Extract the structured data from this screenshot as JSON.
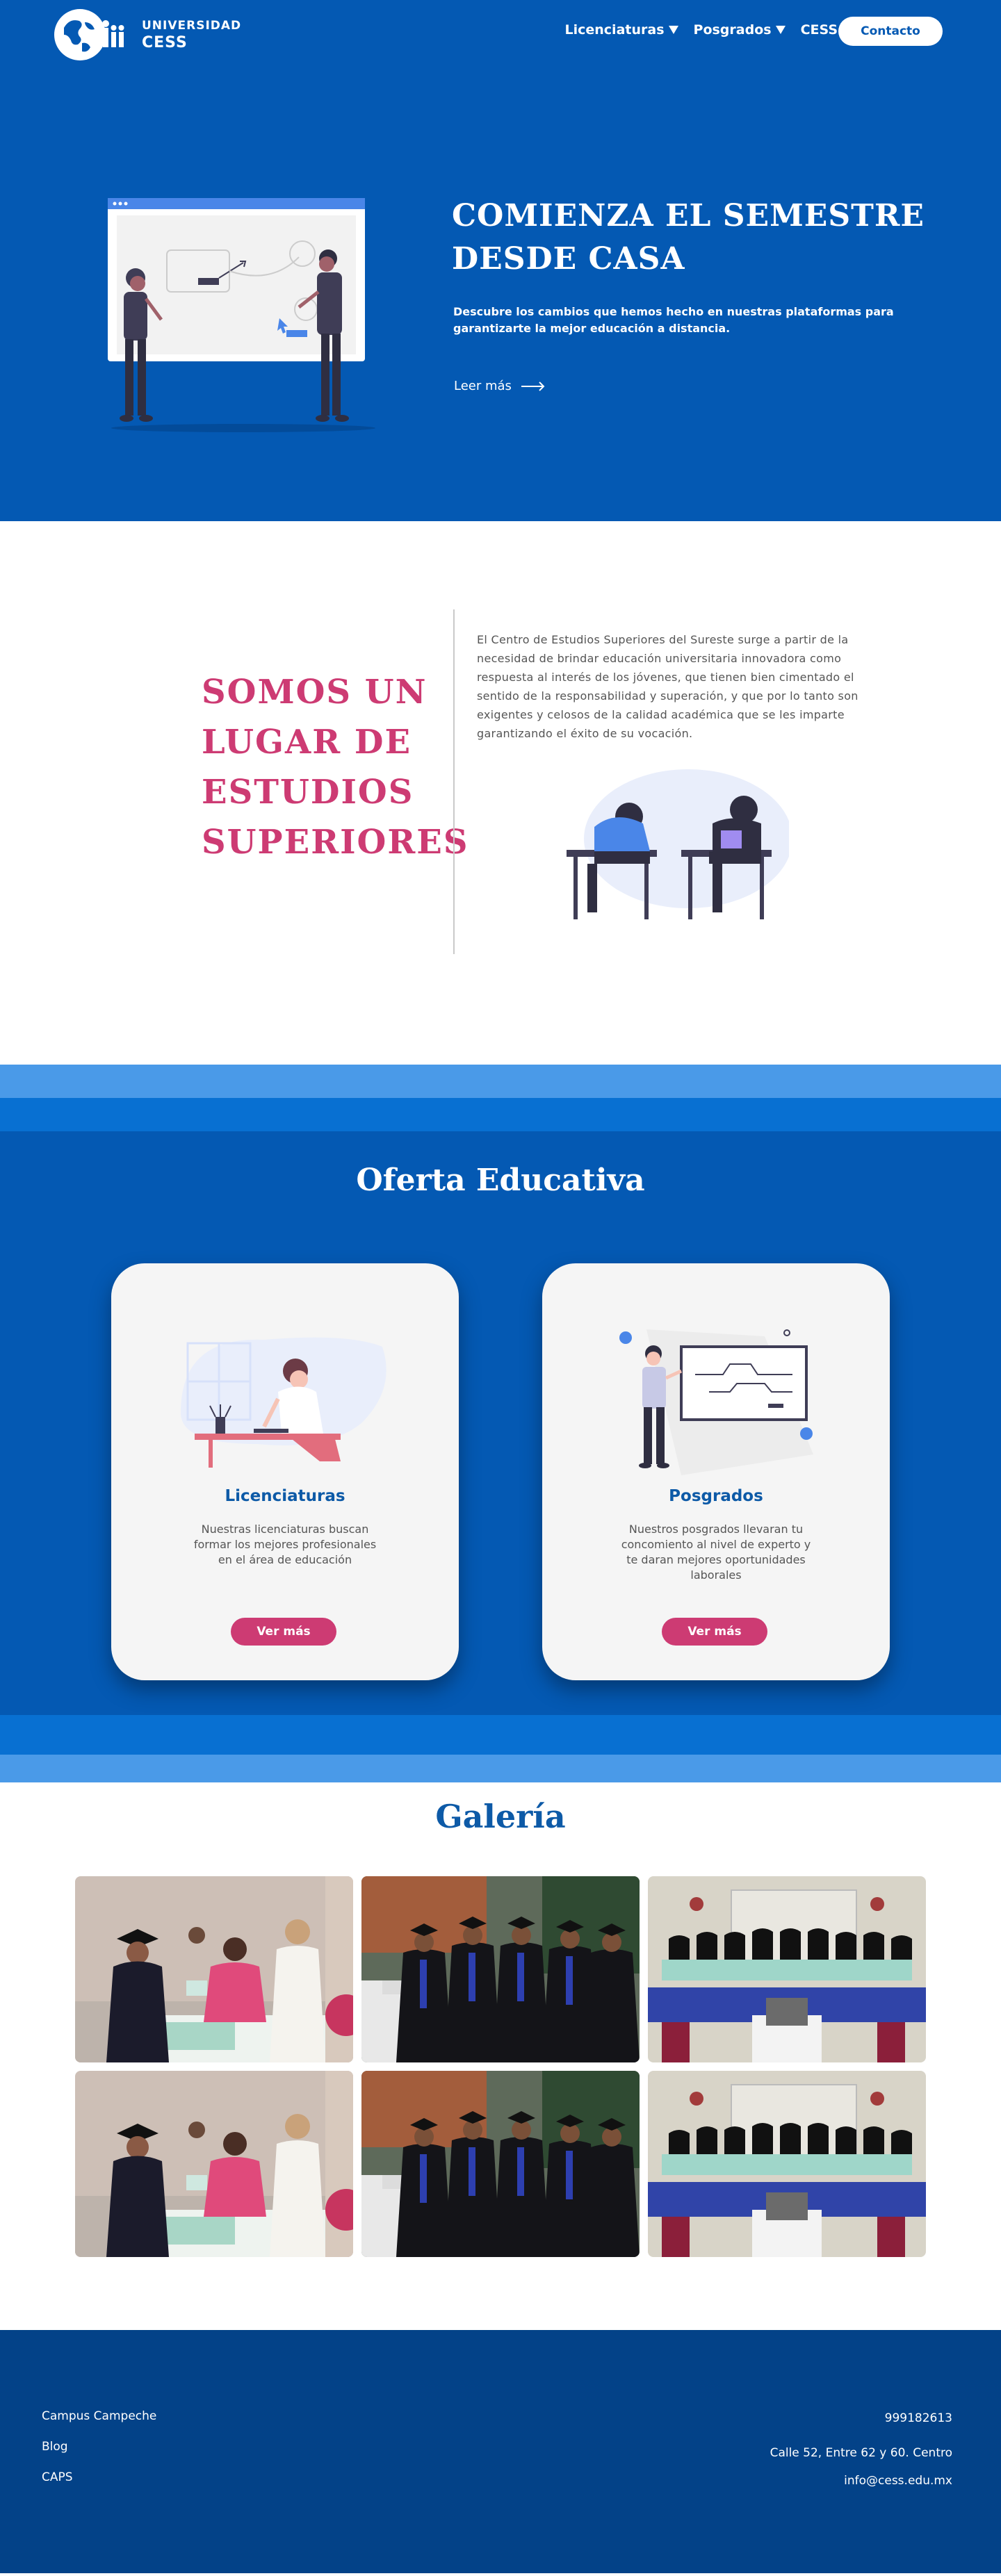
{
  "brand": {
    "logo_line1": "UNIVERSIDAD",
    "logo_line2": "CESS",
    "primary_color": "#0459b3",
    "accent_color": "#cd3b73"
  },
  "nav": {
    "items": [
      {
        "label": "Licenciaturas",
        "icon": "caret-down-icon"
      },
      {
        "label": "Posgrados",
        "icon": "caret-down-icon"
      },
      {
        "label": "CESS",
        "icon": "caret-down-icon"
      }
    ],
    "contact_label": "Contacto"
  },
  "hero": {
    "title": "COMIENZA EL SEMESTRE DESDE CASA",
    "subtitle": "Descubre los cambios que hemos hecho en nuestras plataformas para garantizarte la mejor educación a distancia.",
    "link_label": "Leer más",
    "link_icon": "arrow-right-icon"
  },
  "about": {
    "title": "SOMOS UN LUGAR DE ESTUDIOS SUPERIORES",
    "text": "El Centro de Estudios Superiores del Sureste surge a partir de la necesidad de brindar educación universitaria innovadora como respuesta al interés de los jóvenes, que tienen bien cimentado el sentido de la responsabilidad y superación, y que por lo tanto son exigentes y celosos de la calidad académica que se les imparte garantizando el éxito de su vocación."
  },
  "oferta": {
    "title": "Oferta Educativa",
    "cards": [
      {
        "title": "Licenciaturas",
        "description": "Nuestras licenciaturas buscan formar los mejores profesionales en el área de educación",
        "button": "Ver más"
      },
      {
        "title": "Posgrados",
        "description": "Nuestros posgrados llevaran tu concomiento al nivel de experto y te daran mejores oportunidades laborales",
        "button": "Ver más"
      }
    ]
  },
  "galeria": {
    "title": "Galería",
    "photos": [
      "graduation-diploma-photo",
      "graduates-seated-photo",
      "group-graduation-photo",
      "graduation-diploma-photo",
      "graduates-seated-photo",
      "group-graduation-photo"
    ]
  },
  "footer": {
    "links": [
      "Campus Campeche",
      "Blog",
      "CAPS"
    ],
    "phone": "999182613",
    "address": "Calle 52, Entre 62 y 60. Centro",
    "email": "info@cess.edu.mx"
  }
}
